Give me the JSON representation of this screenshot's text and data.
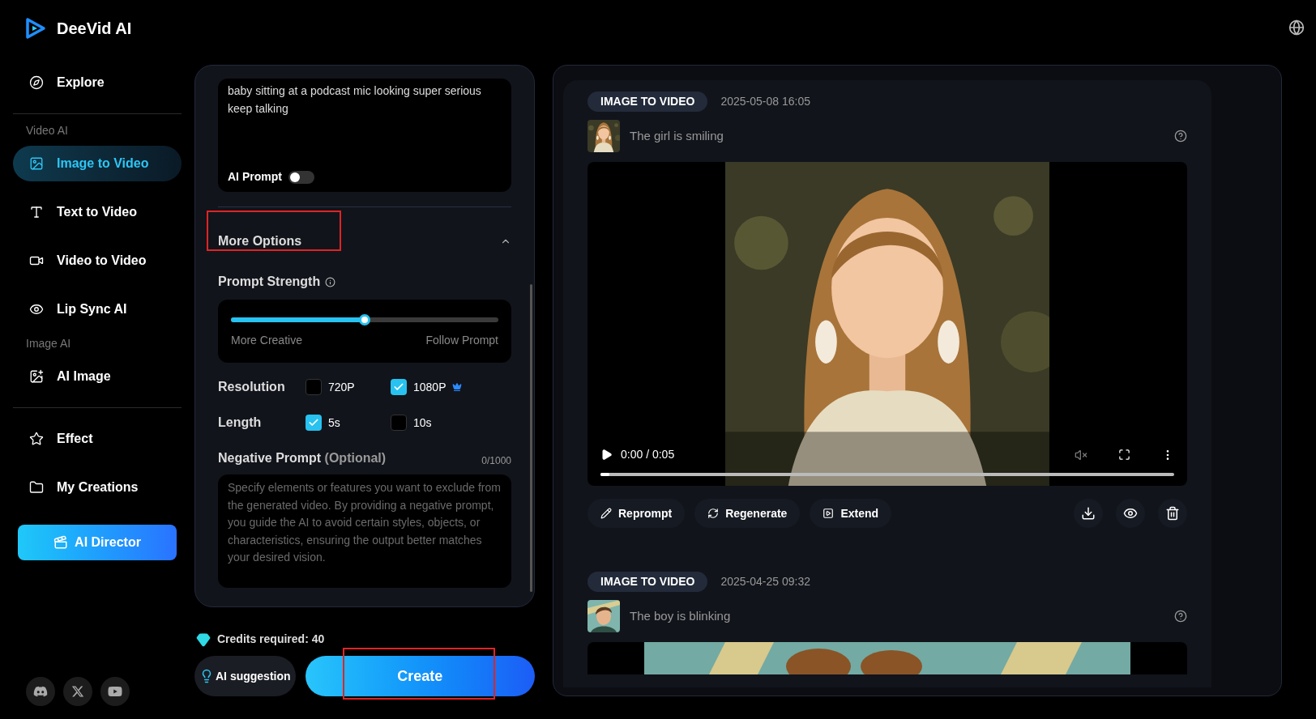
{
  "brand": {
    "name": "DeeVid AI"
  },
  "sidebar": {
    "items": [
      {
        "kind": "link",
        "label": "Explore",
        "selected": false
      },
      {
        "kind": "divider"
      },
      {
        "kind": "heading",
        "label": "Video AI"
      },
      {
        "kind": "link",
        "label": "Image to Video",
        "selected": true
      },
      {
        "kind": "link",
        "label": "Text to Video",
        "selected": false
      },
      {
        "kind": "link",
        "label": "Video to Video",
        "selected": false
      },
      {
        "kind": "link",
        "label": "Lip Sync AI",
        "selected": false
      },
      {
        "kind": "heading",
        "label": "Image AI"
      },
      {
        "kind": "link",
        "label": "AI Image",
        "selected": false
      },
      {
        "kind": "divider"
      },
      {
        "kind": "link",
        "label": "Effect",
        "selected": false
      },
      {
        "kind": "link",
        "label": "My Creations",
        "selected": false
      }
    ],
    "cta": "AI Director"
  },
  "form": {
    "prompt": "baby sitting at a podcast mic looking super serious keep talking",
    "ai_prompt": {
      "label": "AI Prompt",
      "on": false
    },
    "more_options": {
      "label": "More Options",
      "expanded": true,
      "highlighted": true
    },
    "prompt_strength": {
      "label": "Prompt Strength",
      "level": 0.5,
      "min_label": "More Creative",
      "max_label": "Follow Prompt"
    },
    "option_rows": [
      {
        "label": "Resolution",
        "options": [
          {
            "label": "720P",
            "checked": false,
            "premium": false
          },
          {
            "label": "1080P",
            "checked": true,
            "premium": true
          }
        ]
      },
      {
        "label": "Length",
        "options": [
          {
            "label": "5s",
            "checked": true,
            "premium": false
          },
          {
            "label": "10s",
            "checked": false,
            "premium": false
          }
        ]
      }
    ],
    "negative_prompt": {
      "label": "Negative Prompt",
      "optional": "(Optional)",
      "count": "0/1000",
      "placeholder": "Specify elements or features you want to exclude from the generated video. By providing a negative prompt, you guide the AI to avoid certain styles, objects, or characteristics, ensuring the output better matches your desired vision."
    },
    "credits": "Credits required: 40",
    "suggestion": "AI suggestion",
    "create": {
      "label": "Create",
      "highlighted": true
    }
  },
  "results": [
    {
      "tag": "IMAGE TO VIDEO",
      "date": "2025-05-08 16:05",
      "prompt": "The girl is smiling",
      "player": {
        "time": "0:00 / 0:05",
        "level": 0.015
      },
      "actions": [
        "Reprompt",
        "Regenerate",
        "Extend"
      ]
    },
    {
      "tag": "IMAGE TO VIDEO",
      "date": "2025-04-25 09:32",
      "prompt": "The boy is blinking"
    }
  ]
}
